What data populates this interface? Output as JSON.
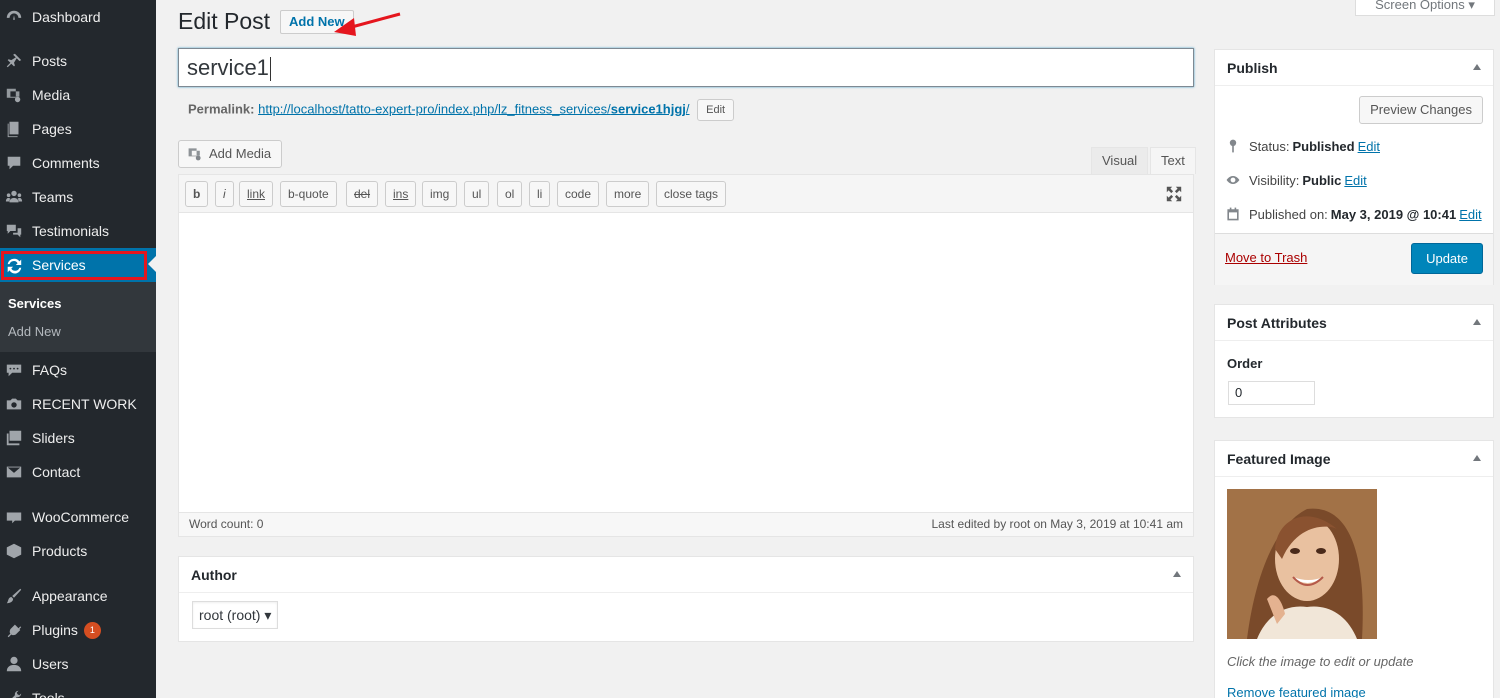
{
  "sidebar": {
    "items": [
      {
        "label": "Dashboard",
        "icon": "dashboard-icon"
      },
      {
        "label": "Posts",
        "icon": "pin-icon"
      },
      {
        "label": "Media",
        "icon": "media-icon"
      },
      {
        "label": "Pages",
        "icon": "pages-icon"
      },
      {
        "label": "Comments",
        "icon": "comment-icon"
      },
      {
        "label": "Teams",
        "icon": "groups-icon"
      },
      {
        "label": "Testimonials",
        "icon": "testimonial-icon"
      },
      {
        "label": "Services",
        "icon": "update-icon"
      },
      {
        "label": "FAQs",
        "icon": "format-chat-icon"
      },
      {
        "label": "RECENT WORK",
        "icon": "camera-icon"
      },
      {
        "label": "Sliders",
        "icon": "images-icon"
      },
      {
        "label": "Contact",
        "icon": "email-icon"
      },
      {
        "label": "WooCommerce",
        "icon": "woo-icon"
      },
      {
        "label": "Products",
        "icon": "box-icon"
      },
      {
        "label": "Appearance",
        "icon": "brush-icon"
      },
      {
        "label": "Plugins",
        "icon": "plugin-icon",
        "badge": "1"
      },
      {
        "label": "Users",
        "icon": "user-icon"
      },
      {
        "label": "Tools",
        "icon": "tools-icon"
      }
    ],
    "submenu": [
      "Services",
      "Add New"
    ]
  },
  "header": {
    "title": "Edit Post",
    "add_new": "Add New",
    "screen_options": "Screen Options ▾"
  },
  "post": {
    "title_value": "service1",
    "permalink_label": "Permalink:",
    "permalink_base": "http://localhost/tatto-expert-pro/index.php/lz_fitness_services/",
    "permalink_slug": "service1hjgj",
    "permalink_tail": "/",
    "permalink_edit": "Edit"
  },
  "editor": {
    "add_media": "Add Media",
    "tab_visual": "Visual",
    "tab_text": "Text",
    "toolbar": [
      "b",
      "i",
      "link",
      "b-quote",
      "del",
      "ins",
      "img",
      "ul",
      "ol",
      "li",
      "code",
      "more",
      "close tags"
    ],
    "word_count": "Word count: 0",
    "last_edited": "Last edited by root on May 3, 2019 at 10:41 am"
  },
  "author": {
    "title": "Author",
    "value": "root (root) ▾"
  },
  "publish": {
    "title": "Publish",
    "preview": "Preview Changes",
    "status_label": "Status:",
    "status_value": "Published",
    "visibility_label": "Visibility:",
    "visibility_value": "Public",
    "published_label": "Published on:",
    "published_value": "May 3, 2019 @ 10:41",
    "edit": "Edit",
    "trash": "Move to Trash",
    "update": "Update"
  },
  "attributes": {
    "title": "Post Attributes",
    "order_label": "Order",
    "order_value": "0"
  },
  "featured": {
    "title": "Featured Image",
    "caption": "Click the image to edit or update",
    "remove": "Remove featured image"
  },
  "colors": {
    "sidebar_bg": "#23282d",
    "accent": "#0073aa",
    "highlight_red": "#e5161e"
  }
}
